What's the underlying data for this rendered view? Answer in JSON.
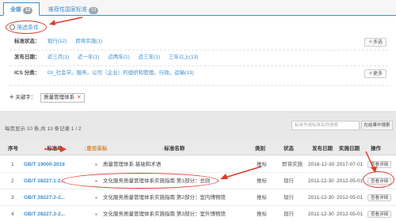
{
  "tabs": [
    {
      "label": "全部",
      "count": "13"
    },
    {
      "label": "推荐性国家标准",
      "count": "13"
    }
  ],
  "filter": {
    "title": "筛选条件",
    "rows": [
      {
        "label": "标准状态：",
        "options": [
          "现行(12)",
          "即将实施(1)"
        ],
        "pill": "多选"
      },
      {
        "label": "发布日期：",
        "options": [
          "近三月(1)",
          "近一年(1)",
          "近两年(1)",
          "近三年(1)",
          "三年以上(13)"
        ]
      },
      {
        "label": "ICS 分类：",
        "options": [
          "03_社会学。服务。公司（企业）的组织和管理。行政。运输(13)"
        ],
        "pill": "更多"
      }
    ],
    "keyword_label": "关键字：",
    "keyword_tag": "质量管理体系"
  },
  "pager": {
    "text": "每页显示 10 条,共 13 条记录  1 / 2"
  },
  "search": {
    "placeholder": "标准号或标准名称搜索",
    "button": "在结果中搜索"
  },
  "table": {
    "headers": [
      "序号",
      "标准号",
      "是否采标",
      "标准名称",
      "类别",
      "状态",
      "发布日期",
      "实施日期",
      "操作"
    ],
    "rows": [
      {
        "idx": "1",
        "no": "GB/T 19000-2016",
        "adopt": "",
        "name": "质量管理体系 基础和术语",
        "cat": "推标",
        "status": "即将实施",
        "pub": "2016-12-30",
        "impl": "2017-07-01",
        "op": "查看详细"
      },
      {
        "idx": "2",
        "no": "GB/T 28227.1-2...",
        "adopt": "",
        "name": "文化服务质量管理体系实施指南 第1部分：总则",
        "cat": "推标",
        "status": "现行",
        "pub": "2011-12-30",
        "impl": "2012-05-01",
        "op": "查看详细"
      },
      {
        "idx": "3",
        "no": "GB/T 28227.2-2...",
        "adopt": "",
        "name": "文化服务质量管理体系实施指南 第2部分：室内博物馆",
        "cat": "推标",
        "status": "现行",
        "pub": "2011-12-30",
        "impl": "2012-05-01",
        "op": "查看详细"
      },
      {
        "idx": "4",
        "no": "GB/T 28227.3-2...",
        "adopt": "",
        "name": "文化服务质量管理体系实施指南 第3部分：室外博物馆",
        "cat": "推标",
        "status": "现行",
        "pub": "2011-12-30",
        "impl": "2012-05-01",
        "op": "查看详细"
      }
    ]
  },
  "colors": {
    "accent": "#3d8fd0",
    "annotation": "#e0392b"
  }
}
